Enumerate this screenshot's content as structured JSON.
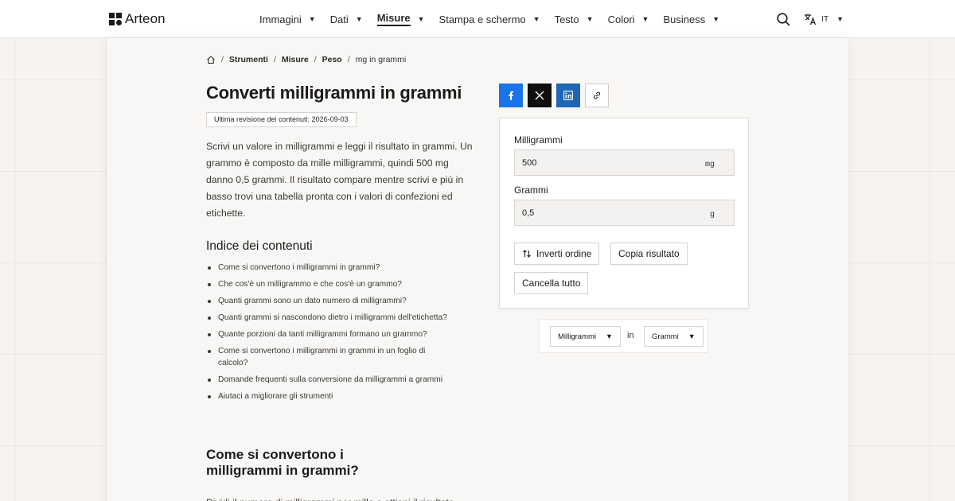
{
  "brand": {
    "name": "Arteon"
  },
  "nav": [
    {
      "label": "Immagini",
      "active": false
    },
    {
      "label": "Dati",
      "active": false
    },
    {
      "label": "Misure",
      "active": true
    },
    {
      "label": "Stampa e schermo",
      "active": false
    },
    {
      "label": "Testo",
      "active": false
    },
    {
      "label": "Colori",
      "active": false
    },
    {
      "label": "Business",
      "active": false
    }
  ],
  "header": {
    "search_icon": "search-icon",
    "language": "IT"
  },
  "breadcrumb": {
    "items": [
      "Strumenti",
      "Misure",
      "Peso"
    ],
    "current": "mg in grammi",
    "separator": "/"
  },
  "page": {
    "title": "Converti milligrammi in grammi",
    "revision": "Ultima revisione dei contenuti: 2026-09-03",
    "intro": "Scrivi un valore in milligrammi e leggi il risultato in grammi. Un grammo è composto da mille milligrammi, quindi 500 mg danno 0,5 grammi. Il risultato compare mentre scrivi e più in basso trovi una tabella pronta con i valori di confezioni ed etichette."
  },
  "toc": {
    "title": "Indice dei contenuti",
    "items": [
      "Come si convertono i milligrammi in grammi?",
      "Che cos'è un milligrammo e che cos'è un grammo?",
      "Quanti grammi sono un dato numero di milligrammi?",
      "Quanti grammi si nascondono dietro i milligrammi dell'etichetta?",
      "Quante porzioni da tanti milligrammi formano un grammo?",
      "Come si convertono i milligrammi in grammi in un foglio di calcolo?",
      "Domande frequenti sulla conversione da milligrammi a grammi",
      "Aiutaci a migliorare gli strumenti"
    ]
  },
  "section": {
    "title": "Come si convertono i milligrammi in grammi?",
    "text": "Dividi il numero di milligrammi per mille e ottieni il risultato"
  },
  "share": {
    "facebook": "facebook-icon",
    "x": "x-icon",
    "linkedin": "linkedin-icon",
    "link": "link-icon"
  },
  "converter": {
    "from_label": "Milligrammi",
    "from_value": "500",
    "from_unit": "mg",
    "to_label": "Grammi",
    "to_value": "0,5",
    "to_unit": "g",
    "swap_label": "Inverti ordine",
    "copy_label": "Copia risultato",
    "clear_label": "Cancella tutto"
  },
  "unit_select": {
    "from": "Milligrammi",
    "connector": "in",
    "to": "Grammi"
  },
  "colors": {
    "facebook": "#1a73e8",
    "x": "#0f0f0f",
    "linkedin": "#1d67b5",
    "text": "#1c1b19"
  }
}
